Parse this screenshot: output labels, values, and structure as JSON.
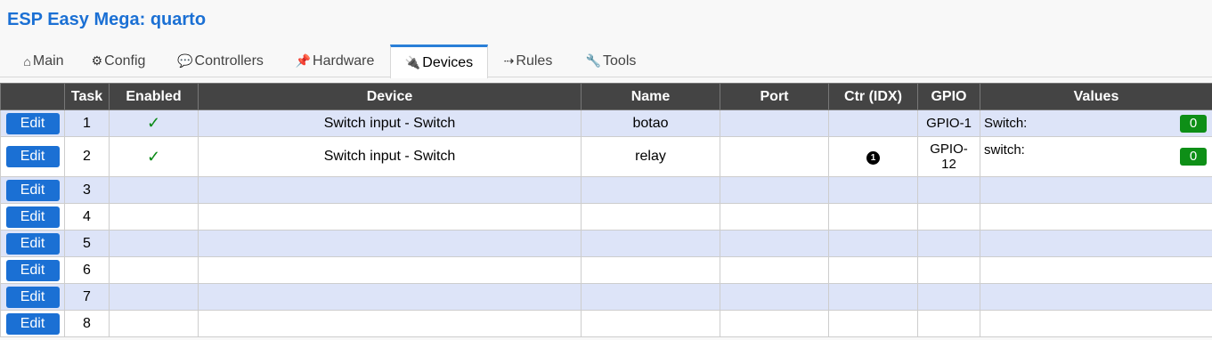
{
  "header": {
    "title": "ESP Easy Mega: quarto"
  },
  "tabs": [
    {
      "label": "Main",
      "icon": "home-icon",
      "icon_glyph": "⌂"
    },
    {
      "label": "Config",
      "icon": "gear-icon",
      "icon_glyph": "⚙"
    },
    {
      "label": "Controllers",
      "icon": "chat-icon",
      "icon_glyph": "💬"
    },
    {
      "label": "Hardware",
      "icon": "pushpin-icon",
      "icon_glyph": "📌"
    },
    {
      "label": "Devices",
      "icon": "plug-icon",
      "icon_glyph": "🔌",
      "active": true
    },
    {
      "label": "Rules",
      "icon": "arrow-right-icon",
      "icon_glyph": "⇢"
    },
    {
      "label": "Tools",
      "icon": "wrench-icon",
      "icon_glyph": "🔧"
    }
  ],
  "table": {
    "headers": {
      "edit": "",
      "task": "Task",
      "enabled": "Enabled",
      "device": "Device",
      "name": "Name",
      "port": "Port",
      "ctr": "Ctr (IDX)",
      "gpio": "GPIO",
      "values": "Values"
    },
    "edit_label": "Edit",
    "check_glyph": "✓",
    "rows": [
      {
        "task": "1",
        "enabled": true,
        "device": "Switch input - Switch",
        "name": "botao",
        "port": "",
        "ctr": "",
        "gpio": "GPIO-1",
        "value_label": "Switch:",
        "value": "0"
      },
      {
        "task": "2",
        "enabled": true,
        "device": "Switch input - Switch",
        "name": "relay",
        "port": "",
        "ctr": "❶",
        "gpio": "GPIO-\n12",
        "value_label": "switch:",
        "value": "0"
      },
      {
        "task": "3"
      },
      {
        "task": "4"
      },
      {
        "task": "5"
      },
      {
        "task": "6"
      },
      {
        "task": "7"
      },
      {
        "task": "8"
      }
    ]
  }
}
